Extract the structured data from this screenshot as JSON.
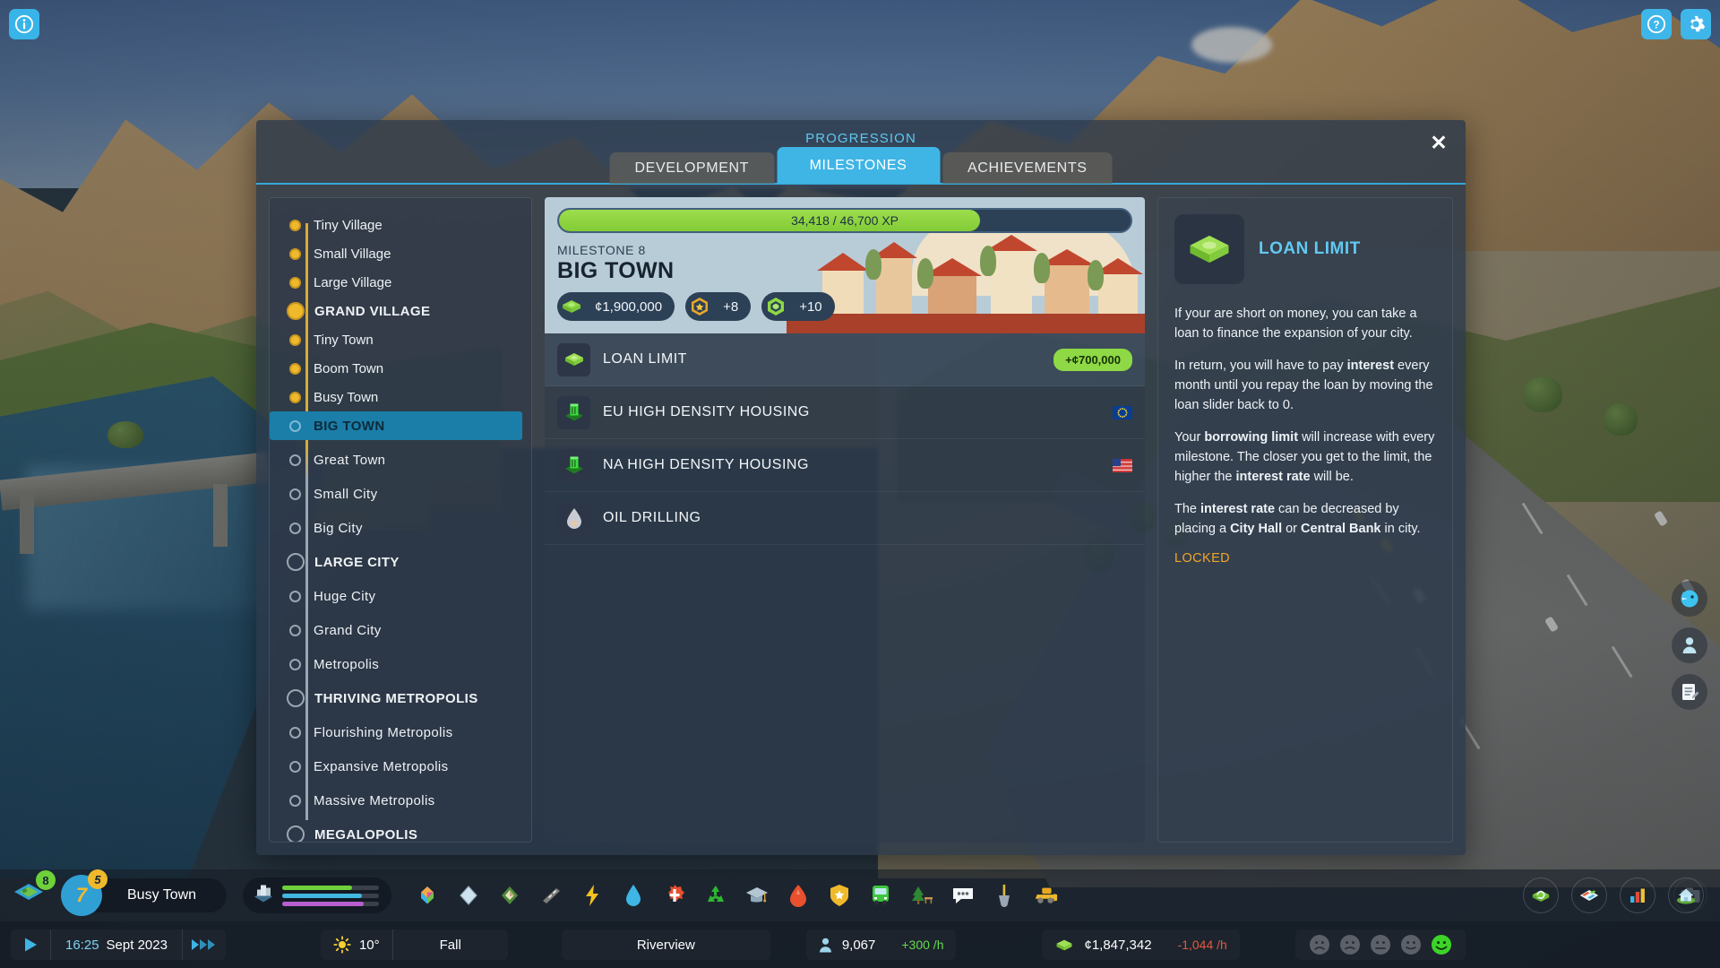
{
  "top": {
    "info_icon": "info-icon",
    "help_icon": "help-icon",
    "settings_icon": "gear-icon"
  },
  "panel": {
    "title": "PROGRESSION",
    "close_label": "✕",
    "tabs": [
      {
        "label": "DEVELOPMENT",
        "active": false
      },
      {
        "label": "MILESTONES",
        "active": true
      },
      {
        "label": "ACHIEVEMENTS",
        "active": false
      }
    ]
  },
  "milestones": [
    {
      "label": "Tiny Village",
      "state": "unlocked",
      "major": false
    },
    {
      "label": "Small Village",
      "state": "unlocked",
      "major": false
    },
    {
      "label": "Large Village",
      "state": "unlocked",
      "major": false
    },
    {
      "label": "GRAND VILLAGE",
      "state": "unlocked",
      "major": true
    },
    {
      "label": "Tiny Town",
      "state": "unlocked",
      "major": false
    },
    {
      "label": "Boom Town",
      "state": "unlocked",
      "major": false
    },
    {
      "label": "Busy Town",
      "state": "unlocked",
      "major": false
    },
    {
      "label": "BIG TOWN",
      "state": "current",
      "major": false
    },
    {
      "label": "Great Town",
      "state": "locked",
      "major": false
    },
    {
      "label": "Small City",
      "state": "locked",
      "major": false
    },
    {
      "label": "Big City",
      "state": "locked",
      "major": false
    },
    {
      "label": "LARGE CITY",
      "state": "locked",
      "major": true
    },
    {
      "label": "Huge City",
      "state": "locked",
      "major": false
    },
    {
      "label": "Grand City",
      "state": "locked",
      "major": false
    },
    {
      "label": "Metropolis",
      "state": "locked",
      "major": false
    },
    {
      "label": "THRIVING METROPOLIS",
      "state": "locked",
      "major": true
    },
    {
      "label": "Flourishing Metropolis",
      "state": "locked",
      "major": false
    },
    {
      "label": "Expansive Metropolis",
      "state": "locked",
      "major": false
    },
    {
      "label": "Massive Metropolis",
      "state": "locked",
      "major": false
    },
    {
      "label": "MEGALOPOLIS",
      "state": "locked",
      "major": true
    }
  ],
  "hero": {
    "xp_text": "34,418 / 46,700 XP",
    "xp_current": 34418,
    "xp_target": 46700,
    "xp_percent": 73.7,
    "milestone_number": "MILESTONE 8",
    "milestone_name": "BIG TOWN",
    "rewards": [
      {
        "icon": "cash-icon",
        "value": "¢1,900,000"
      },
      {
        "icon": "expansion-permit-icon",
        "value": "+8"
      },
      {
        "icon": "development-point-icon",
        "value": "+10"
      }
    ]
  },
  "reward_rows": [
    {
      "name": "LOAN LIMIT",
      "icon": "cash-bundle-icon",
      "badge": "+¢700,000",
      "flag": null,
      "selected": true
    },
    {
      "name": "EU HIGH DENSITY HOUSING",
      "icon": "high-density-building-icon",
      "badge": null,
      "flag": "eu",
      "selected": false
    },
    {
      "name": "NA HIGH DENSITY HOUSING",
      "icon": "high-density-building-icon",
      "badge": null,
      "flag": "us",
      "selected": false
    },
    {
      "name": "OIL DRILLING",
      "icon": "oil-drop-icon",
      "badge": null,
      "flag": null,
      "selected": false
    }
  ],
  "detail": {
    "icon": "cash-bundle-icon",
    "title": "LOAN LIMIT",
    "paragraphs": [
      "If your are short on money, you can take a loan to finance the expansion of your city.",
      "In return, you will have to pay interest every month until you repay the loan by moving the loan slider back to 0.",
      "Your borrowing limit will increase with every milestone. The closer you get to the limit, the higher the interest rate will be.",
      "The interest rate can be decreased by placing a City Hall or Central Bank in city."
    ],
    "status": "LOCKED"
  },
  "hud": {
    "xp_level": "7",
    "xp_level_badge": "5",
    "map_tile_badge": "8",
    "city_milestone": "Busy Town",
    "demand": {
      "residential_pct": 72,
      "commercial_pct": 82,
      "industrial_pct": 84
    },
    "tool_icons": [
      "zones-icon",
      "areas-icon",
      "terrain-icon",
      "roads-icon",
      "electricity-icon",
      "water-icon",
      "healthcare-icon",
      "garbage-icon",
      "education-icon",
      "fire-icon",
      "police-icon",
      "transportation-icon",
      "parks-icon",
      "communications-icon",
      "landscaping-icon",
      "bulldoze-icon"
    ],
    "round_icons": [
      "economy-icon",
      "map-overlays-icon",
      "statistics-icon",
      "city-info-icon"
    ],
    "camera_icon": "photo-mode-icon",
    "side_buttons": [
      "chirper-icon",
      "citizen-icon",
      "notes-icon"
    ],
    "play_icon": "play-icon",
    "fastforward_icon": "fast-forward-icon",
    "time": "16:25",
    "date": "Sept 2023",
    "weather_icon": "sun-icon",
    "temperature": "10°",
    "season": "Fall",
    "city_name": "Riverview",
    "population": {
      "icon": "population-icon",
      "value": "9,067",
      "rate": "+300 /h",
      "rate_sign": "pos"
    },
    "money": {
      "icon": "money-icon",
      "value": "¢1,847,342",
      "rate": "-1,044 /h",
      "rate_sign": "neg"
    },
    "happiness_faces": 5,
    "happiness_active_index": 4
  },
  "colors": {
    "accent_blue": "#3fb5e5",
    "title_blue": "#5ec8f0",
    "xp_green": "#8ed945",
    "locked_orange": "#efa724",
    "current_highlight": "#1a7ea8",
    "milestone_gold": "#f0b92c"
  }
}
